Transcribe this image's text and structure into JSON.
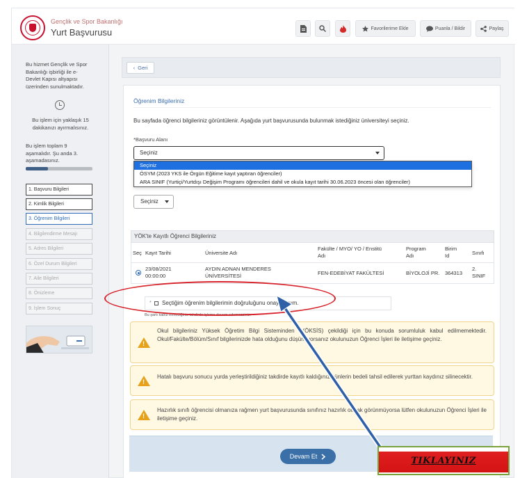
{
  "header": {
    "ministry": "Gençlik ve Spor Bakanlığı",
    "title": "Yurt Başvurusu",
    "buttons": {
      "favorites": "Favorilerime Ekle",
      "rate": "Puanla / Bildir",
      "share": "Paylaş"
    }
  },
  "sidebar": {
    "service_info": [
      "Bu hizmet Gençlik ve Spor",
      "Bakanlığı işbirliği ile e-",
      "Devlet Kapısı altyapısı",
      "üzerinden sunulmaktadır."
    ],
    "time_info": [
      "Bu işlem için yaklaşık 15",
      "dakikanızı ayırmalısınız."
    ],
    "steps_info": [
      "Bu işlem toplam 9",
      "aşamalıdır. Şu anda 3.",
      "aşamadasınız."
    ],
    "progress": 0.33,
    "steps": [
      "1. Başvuru Bilgileri",
      "2. Kimlik Bilgileri",
      "3. Öğrenim Bilgileri",
      "4. Bilgilendirme Mesajı",
      "5. Adres Bilgileri",
      "6. Özel Durum Bilgileri",
      "7. Aile Bilgileri",
      "8. Önizleme",
      "9. İşlem Sonuç"
    ]
  },
  "main": {
    "back_label": "Geri",
    "section_title": "Öğrenim Bilgileriniz",
    "description": "Bu sayfada öğrenci bilgileriniz görüntülenir. Aşağıda yurt başvurusunda bulunmak istediğiniz üniversiteyi seçiniz.",
    "field_label": "*Başvuru Alanı",
    "select_value": "Seçiniz",
    "options": [
      "Seçiniz",
      "ÖSYM (2023 YKS ile Örgün Eğitime kayıt yaptıran öğrenciler)",
      "ARA SINIF (Yurtiçi/Yurtdışı Değişim Programı öğrencileri dahil ve okula kayıt tarihi 30.06.2023 öncesi olan öğrenciler)"
    ],
    "small_select_value": "Seçiniz",
    "yok_title": "YÖK'te Kayıtlı Öğrenci Bilgileriniz",
    "table": {
      "headers": {
        "sec": "Seç",
        "kayit": "Kayıt Tarihi",
        "universite": "Üniversite Adı",
        "fakulte_1": "Fakülte / MYO/ YO / Enstitü",
        "fakulte_2": "Adı",
        "program_1": "Program",
        "program_2": "Adı",
        "birim_1": "Birim",
        "birim_2": "Id",
        "sinif": "Sınıfı"
      },
      "row": {
        "date_1": "23/08/2021",
        "date_2": "00:00:00",
        "uni_1": "AYDIN ADNAN MENDERES",
        "uni_2": "ÜNİVERSİTESİ",
        "faculty": "FEN-EDEBİYAT FAKÜLTESİ",
        "program": "BİYOLOJİ PR.",
        "birim": "364313",
        "sinif_1": "2.",
        "sinif_2": "SINIF"
      }
    },
    "confirm_label": "Seçtiğim öğrenim bilgilerimin doğruluğunu onaylıyorum.",
    "confirm_star": "*",
    "note": "Bu şartı kabul etmediğiniz takdirde işleme devam edemezsiniz.",
    "warnings": [
      "Okul bilgileriniz Yüksek Öğretim Bilgi Sisteminden (YÖKSİS) çekildiği için bu konuda sorumluluk kabul edilmemektedir. Okul/Fakülte/Bölüm/Sınıf bilgilerinizde hata olduğunu düşünüyorsanız okulunuzun Öğrenci İşleri ile iletişime geçiniz.",
      "Hatalı başvuru sonucu yurda yerleştirildiğiniz takdirde kayıtlı kaldığınız günlerin bedeli tahsil edilerek yurttan kaydınız silinecektir.",
      "Hazırlık sınıfı öğrencisi olmanıza rağmen yurt başvurusunda sınıfınız hazırlık olarak görünmüyorsa lütfen okulunuzun Öğrenci İşleri ile iletişime geçiniz."
    ],
    "continue_label": "Devam Et"
  },
  "annotation": {
    "label": "TIKLAYINIZ",
    "ellipse_color": "#d8222a",
    "arrow_color": "#2f5fa6"
  },
  "colors": {
    "accent": "#3b6db3",
    "warning_bg": "#fff8e3",
    "warning_icon": "#e5a21a"
  }
}
